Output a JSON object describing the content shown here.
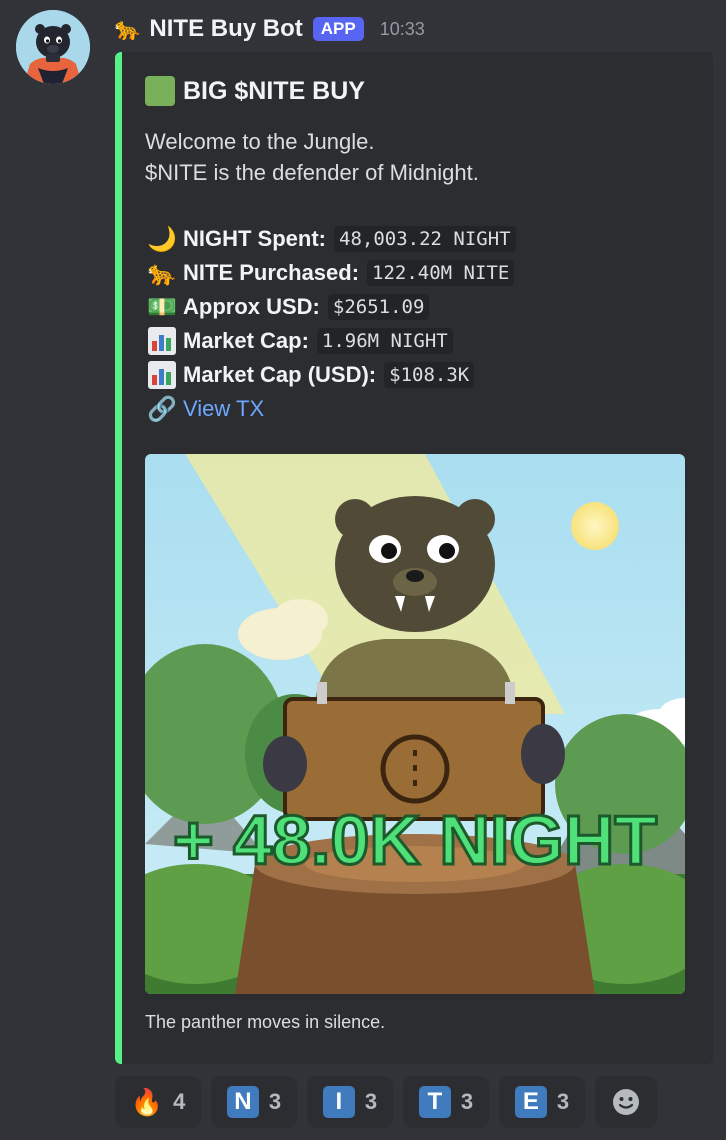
{
  "message": {
    "bot_emoji": "🐆",
    "bot_name": "NITE Buy Bot",
    "app_badge": "APP",
    "timestamp": "10:33"
  },
  "embed": {
    "accent_color": "#57f287",
    "title": "BIG $NITE BUY",
    "description_line1": "Welcome to the Jungle.",
    "description_line2": "$NITE is the defender of Midnight.",
    "fields": [
      {
        "icon": "🌙",
        "label": "NIGHT Spent:",
        "value": "48,003.22 NIGHT"
      },
      {
        "icon": "🐆",
        "label": "NITE Purchased:",
        "value": "122.40M NITE"
      },
      {
        "icon": "💵",
        "label": "Approx USD:",
        "value": "$2651.09"
      },
      {
        "icon": "bar-chart",
        "label": "Market Cap:",
        "value": "1.96M NIGHT"
      },
      {
        "icon": "bar-chart",
        "label": "Market Cap (USD):",
        "value": "$108.3K"
      }
    ],
    "link_icon": "🔗",
    "link_text": "View TX",
    "image_overlay_text": "+ 48.0K NIGHT",
    "caption": "The panther moves in silence."
  },
  "reactions": [
    {
      "emoji": "🔥",
      "count": "4"
    },
    {
      "letter": "N",
      "count": "3"
    },
    {
      "letter": "I",
      "count": "3"
    },
    {
      "letter": "T",
      "count": "3"
    },
    {
      "letter": "E",
      "count": "3"
    }
  ],
  "add_reaction_icon": "smiley-add-reaction-icon"
}
